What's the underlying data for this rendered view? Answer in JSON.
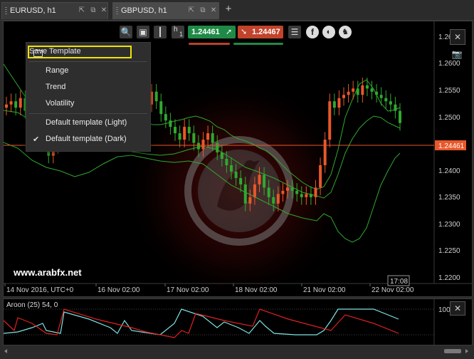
{
  "tabs": [
    {
      "label": "EURUSD, h1",
      "active": false
    },
    {
      "label": "GBPUSD, h1",
      "active": true
    }
  ],
  "toolbar": {
    "timeframe_letter": "h",
    "timeframe_number": "1",
    "buy_price": "1.24461",
    "sell_price": "1.24467",
    "buy_color": "#1f8a47",
    "sell_color": "#c2432b"
  },
  "menu": {
    "items": [
      "Save Template",
      "Range",
      "Trend",
      "Volatility",
      "Default template (Light)",
      "Default template (Dark)"
    ],
    "checked_item": "Default template (Dark)"
  },
  "price_axis": {
    "labels": [
      "1.26",
      "1.2600",
      "1.2550",
      "1.2500",
      "1.2400",
      "1.2350",
      "1.2300",
      "1.2250",
      "1.2200"
    ],
    "current_price": "1.24461",
    "current_price_color": "#e8582a"
  },
  "time_axis": {
    "labels": [
      "14 Nov 2016, UTC+0",
      "16 Nov 02:00",
      "17 Nov 02:00",
      "18 Nov 02:00",
      "21 Nov 02:00",
      "22 Nov 02:00"
    ],
    "crosshair_time": "17:08"
  },
  "watermark": "www.arabfx.net",
  "aroon": {
    "title": "Aroon (25) 54, 0",
    "level_label": "100",
    "up_color": "#7fe3e3",
    "down_color": "#e02020"
  },
  "chart_data": {
    "type": "candlestick",
    "symbol": "GBPUSD",
    "timeframe": "h1",
    "ylim": [
      1.2195,
      1.2605
    ],
    "current_price": 1.24461,
    "closes": [
      1.2475,
      1.248,
      1.247,
      1.2485,
      1.2465,
      1.245,
      1.246,
      1.244,
      1.242,
      1.2395,
      1.241,
      1.2435,
      1.2455,
      1.2445,
      1.243,
      1.245,
      1.247,
      1.244,
      1.242,
      1.243,
      1.2425,
      1.2445,
      1.2455,
      1.244,
      1.2435,
      1.2445,
      1.243,
      1.242,
      1.244,
      1.246,
      1.2475,
      1.2495,
      1.248,
      1.246,
      1.245,
      1.244,
      1.243,
      1.242,
      1.244,
      1.243,
      1.2415,
      1.2405,
      1.242,
      1.243,
      1.2415,
      1.24,
      1.239,
      1.238,
      1.237,
      1.236,
      1.235,
      1.232,
      1.233,
      1.235,
      1.2365,
      1.2345,
      1.233,
      1.232,
      1.2335,
      1.234,
      1.2345,
      1.234,
      1.2335,
      1.233,
      1.2335,
      1.233,
      1.2345,
      1.238,
      1.242,
      1.248,
      1.247,
      1.2485,
      1.249,
      1.2495,
      1.25,
      1.249,
      1.2505,
      1.25,
      1.2495,
      1.249,
      1.2485,
      1.248,
      1.2475,
      1.2465,
      1.2446
    ]
  }
}
